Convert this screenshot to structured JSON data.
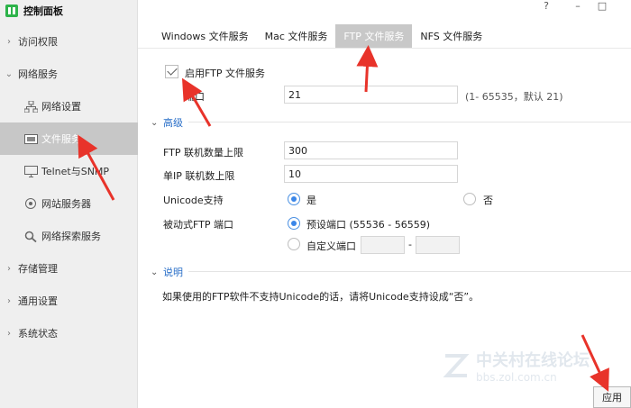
{
  "app": {
    "title": "控制面板"
  },
  "window": {
    "help_label": "?",
    "minimize_label": "–",
    "maximize_label": "□"
  },
  "sidebar": {
    "items": [
      {
        "label": "访问权限",
        "expanded": false
      },
      {
        "label": "网络服务",
        "expanded": true
      },
      {
        "label": "存储管理",
        "expanded": false
      },
      {
        "label": "通用设置",
        "expanded": false
      },
      {
        "label": "系统状态",
        "expanded": false
      }
    ],
    "sub_items": [
      {
        "label": "网络设置",
        "icon": "network-icon",
        "active": false
      },
      {
        "label": "文件服务",
        "icon": "file-service-icon",
        "active": true
      },
      {
        "label": "Telnet与SNMP",
        "icon": "telnet-icon",
        "active": false
      },
      {
        "label": "网站服务器",
        "icon": "web-server-icon",
        "active": false
      },
      {
        "label": "网络探索服务",
        "icon": "discovery-icon",
        "active": false
      }
    ]
  },
  "tabs": [
    {
      "label": "Windows 文件服务",
      "active": false
    },
    {
      "label": "Mac 文件服务",
      "active": false
    },
    {
      "label": "FTP 文件服务",
      "active": true
    },
    {
      "label": "NFS 文件服务",
      "active": false
    }
  ],
  "ftp": {
    "enable_label": "启用FTP 文件服务",
    "enable_checked": true,
    "port_label": "端口",
    "port_value": "21",
    "port_hint": "(1- 65535，默认 21)"
  },
  "advanced": {
    "header": "高级",
    "max_conn_label": "FTP 联机数量上限",
    "max_conn_value": "300",
    "per_ip_label": "单IP 联机数上限",
    "per_ip_value": "10",
    "unicode_label": "Unicode支持",
    "unicode_yes": "是",
    "unicode_no": "否",
    "unicode_selected": "是",
    "passive_label": "被动式FTP 端口",
    "passive_default": "预设端口 (55536 - 56559)",
    "passive_custom": "自定义端口",
    "passive_dash": "-",
    "passive_selected": "预设端口"
  },
  "notes": {
    "header": "说明",
    "text": "如果使用的FTP软件不支持Unicode的话，请将Unicode支持设成“否”。"
  },
  "apply_label": "应用",
  "watermark": {
    "line1": "中关村在线论坛",
    "line2": "bbs.zol.com.cn"
  },
  "colors": {
    "accent": "#3a86e8",
    "annotation": "#e8332a",
    "brand": "#2db34a",
    "active_bg": "#c7c7c7"
  }
}
